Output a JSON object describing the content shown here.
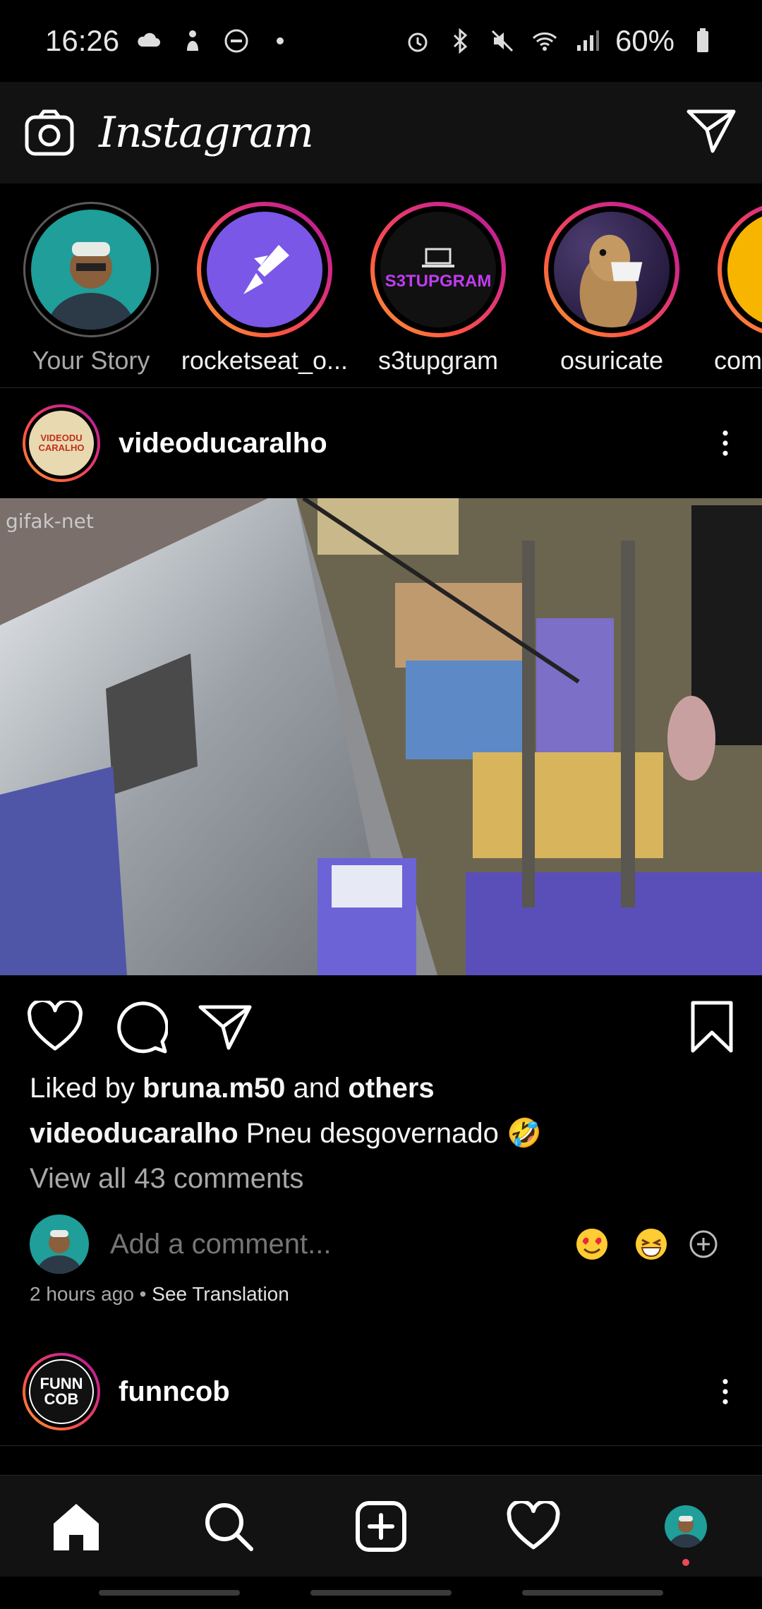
{
  "status_bar": {
    "time": "16:26",
    "battery": "60%",
    "icons": [
      "cloud-icon",
      "notification-icon",
      "dnd-icon",
      "dot-icon",
      "alarm-icon",
      "bluetooth-icon",
      "mute-icon",
      "wifi-icon",
      "signal-icon",
      "battery-icon"
    ]
  },
  "header": {
    "title": "Instagram",
    "left_icon": "camera-icon",
    "right_icon": "direct-message-icon"
  },
  "stories": [
    {
      "label": "Your Story"
    },
    {
      "label": "rocketseat_o..."
    },
    {
      "label": "s3tupgram",
      "logo_text": "S3TUPGRAM"
    },
    {
      "label": "osuricate"
    },
    {
      "label": "com"
    }
  ],
  "post": {
    "username": "videoducaralho",
    "avatar_text": "VIDEODU CARALHO",
    "watermark": "gifak-net",
    "liked_prefix": "Liked by",
    "liked_user": "bruna.m50",
    "liked_and": "and",
    "liked_others": "others",
    "caption_user": "videoducaralho",
    "caption_text": "Pneu desgovernado",
    "caption_emoji": "🤣",
    "view_comments": "View all 43 comments",
    "comment_placeholder": "Add a comment...",
    "time_ago": "2 hours ago",
    "separator": "•",
    "see_translation": "See Translation"
  },
  "next_post": {
    "username": "funncob",
    "avatar_text_1": "FUNN",
    "avatar_text_2": "COB"
  },
  "bottom_nav": [
    "home-icon",
    "search-icon",
    "new-post-icon",
    "activity-icon",
    "profile-icon"
  ],
  "colors": {
    "story_ring": "#d92e7f",
    "background": "#000000",
    "header": "#121212",
    "muted": "#a8a8a8"
  }
}
